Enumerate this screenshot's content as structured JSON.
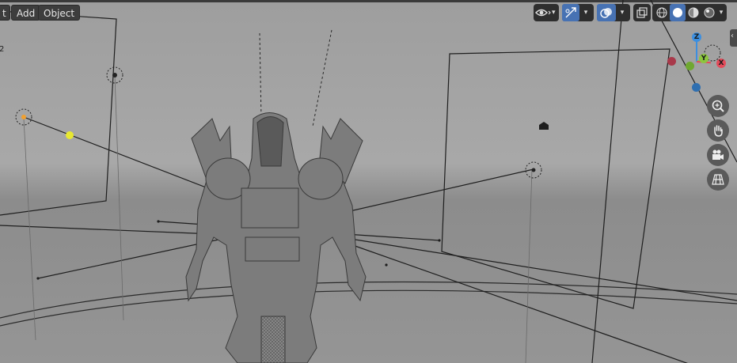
{
  "header": {
    "menu": {
      "cut_label": "t",
      "add_label": "Add",
      "object_label": "Object"
    },
    "left_edge_number": "2"
  },
  "gizmo": {
    "z_label": "Z",
    "y_label": "Y",
    "x_label": "X"
  },
  "icons": [
    "view-object-types-icon",
    "gizmo-toggle-icon",
    "overlay-icon",
    "xray-icon",
    "wireframe-shading-icon",
    "solid-shading-icon",
    "material-shading-icon",
    "rendered-shading-icon",
    "zoom-icon",
    "pan-hand-icon",
    "camera-view-icon",
    "perspective-grid-icon"
  ],
  "colors": {
    "active_toggle": "#4772b3",
    "axis_x": "#e34b5a",
    "axis_y": "#8cc63f",
    "axis_z": "#3c8fe0",
    "selected_light": "#e8e830",
    "active_origin": "#f0a030"
  }
}
